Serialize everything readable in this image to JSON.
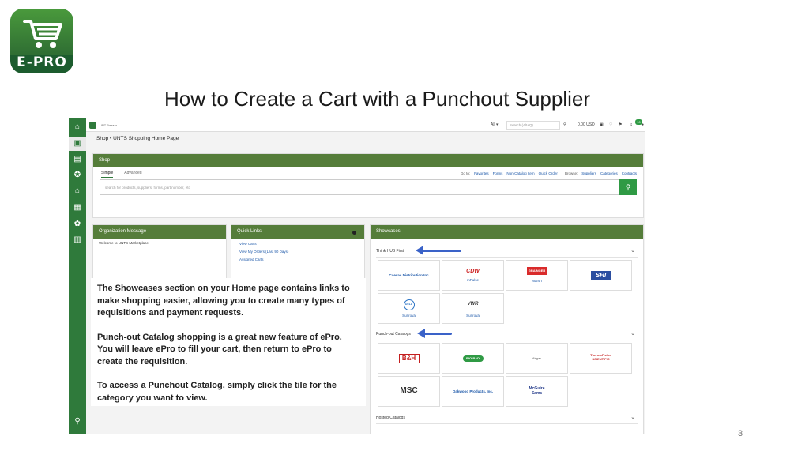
{
  "slide": {
    "title": "How to Create a Cart with a Punchout Supplier",
    "page_number": "3",
    "logo_text": "E-PRO"
  },
  "app": {
    "topbar": {
      "brand_text": "UNT Bazaar",
      "scope_label": "All",
      "search_placeholder": "Search (Alt+Q)",
      "cart_total": "0.00 USD",
      "notification_count": "10"
    },
    "breadcrumb": {
      "root": "Shop",
      "current": "UNTS Shopping Home Page"
    },
    "shop_panel": {
      "title": "Shop",
      "tabs": [
        "Simple",
        "Advanced"
      ],
      "goto_label": "Go to:",
      "goto_links": [
        "Favorites",
        "Forms",
        "Non-Catalog Item",
        "Quick Order"
      ],
      "browse_label": "Browse:",
      "browse_links": [
        "Suppliers",
        "Categories",
        "Contracts"
      ],
      "search_placeholder": "search for products, suppliers, forms, part number, etc"
    },
    "org_panel": {
      "title": "Organization Message",
      "message": "Welcome to UNTS Marketplace!"
    },
    "quick_links": {
      "title": "Quick Links",
      "items": [
        "View Carts",
        "View My Orders (Last 90 Days)",
        "Assigned Carts"
      ]
    },
    "callout": {
      "paragraphs": [
        "The Showcases section on your Home page contains links to make shopping easier, allowing you to create many types of requisitions and payment requests.",
        "Punch-out Catalog shopping is a great new feature of ePro. You will leave ePro to fill your cart, then return to ePro to create the requisition.",
        "To access a Punchout Catalog, simply click the tile for the category you want to view."
      ]
    },
    "showcases": {
      "title": "Showcases",
      "sections": [
        {
          "label": "Think HUB First",
          "tiles": [
            {
              "name": "Cuevas Distribution Inc",
              "sub": ""
            },
            {
              "name": "CDW",
              "sub": "mPulse"
            },
            {
              "name": "GRAINGER",
              "sub": "Marsh"
            },
            {
              "name": "SHI",
              "sub": ""
            },
            {
              "name": "DELL",
              "sub": "Sunrova"
            },
            {
              "name": "VWR",
              "sub": "Sunrova"
            }
          ]
        },
        {
          "label": "Punch-out Catalogs",
          "tiles": [
            {
              "name": "B&H",
              "sub": ""
            },
            {
              "name": "BIO-RAD",
              "sub": ""
            },
            {
              "name": "Airgas",
              "sub": ""
            },
            {
              "name": "ThermoFisher SCIENTIFIC",
              "sub": ""
            },
            {
              "name": "MSC",
              "sub": ""
            },
            {
              "name": "Oakwood Products, Inc.",
              "sub": ""
            },
            {
              "name": "McGuire Sams",
              "sub": ""
            }
          ]
        },
        {
          "label": "Hosted Catalogs",
          "tiles": []
        }
      ]
    },
    "colors": {
      "accent_green": "#557d3a",
      "nav_green": "#2f7a3b",
      "button_green": "#2f9a44",
      "link_blue": "#1a56a8",
      "annotation_arrow": "#3a62c8"
    },
    "nav_icons": [
      "home-icon",
      "cart-icon",
      "documents-icon",
      "award-icon",
      "bank-icon",
      "truck-icon",
      "settings-icon",
      "chart-icon",
      "search-icon"
    ]
  }
}
